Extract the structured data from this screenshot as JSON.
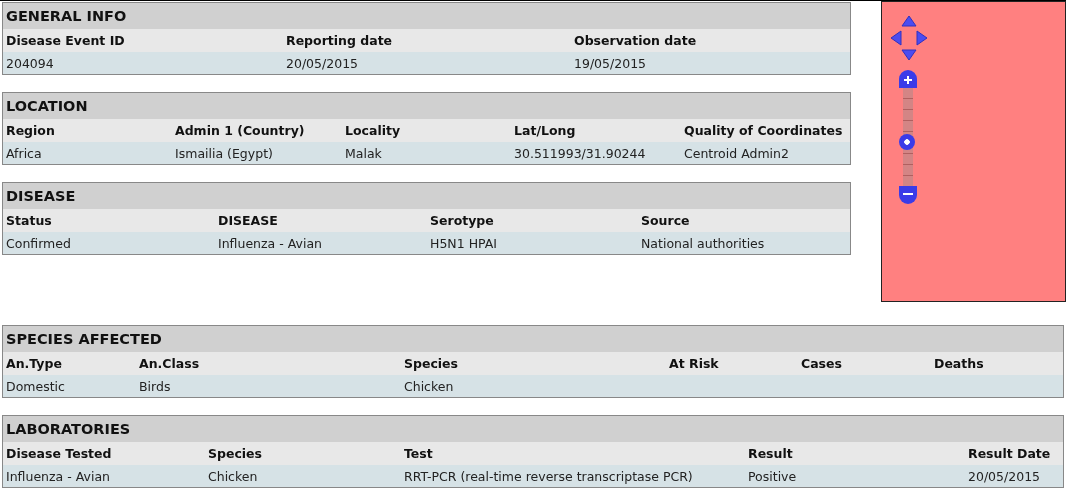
{
  "sections": [
    {
      "title": "GENERAL INFO",
      "columns": [
        "Disease Event ID",
        "Reporting date",
        "Observation date"
      ],
      "rows": [
        [
          "204094",
          "20/05/2015",
          "19/05/2015"
        ]
      ]
    },
    {
      "title": "LOCATION",
      "columns": [
        "Region",
        "Admin 1 (Country)",
        "Locality",
        "Lat/Long",
        "Quality of Coordinates"
      ],
      "rows": [
        [
          "Africa",
          "Ismailia (Egypt)",
          "Malak",
          "30.511993/31.90244",
          "Centroid Admin2"
        ]
      ]
    },
    {
      "title": "DISEASE",
      "columns": [
        "Status",
        "DISEASE",
        "Serotype",
        "Source"
      ],
      "rows": [
        [
          "Confirmed",
          "Influenza - Avian",
          "H5N1 HPAI",
          "National authorities"
        ]
      ]
    },
    {
      "title": "SPECIES AFFECTED",
      "columns": [
        "An.Type",
        "An.Class",
        "Species",
        "At Risk",
        "Cases",
        "Deaths"
      ],
      "rows": [
        [
          "Domestic",
          "Birds",
          "Chicken"
        ]
      ]
    },
    {
      "title": "LABORATORIES",
      "columns": [
        "Disease Tested",
        "Species",
        "Test",
        "Result",
        "Result Date"
      ],
      "rows": [
        [
          "Influenza - Avian",
          "Chicken",
          "RRT-PCR (real-time reverse transcriptase PCR)",
          "Positive",
          "20/05/2015"
        ]
      ]
    }
  ],
  "map": {
    "zoom": {
      "level": 0.45
    }
  }
}
